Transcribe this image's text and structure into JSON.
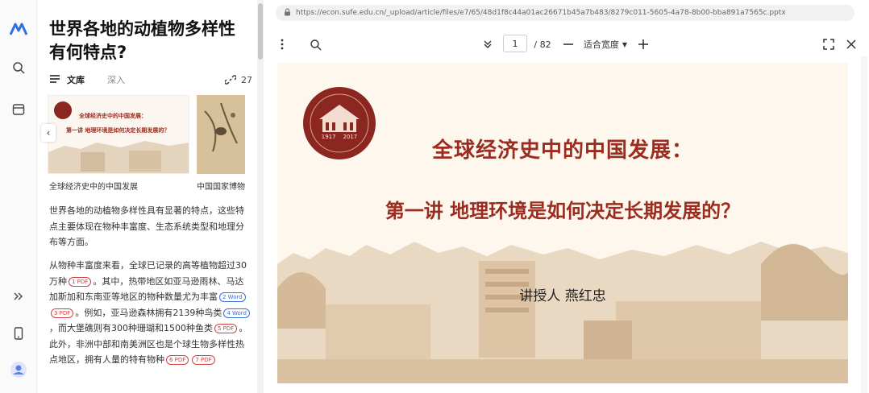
{
  "left_rail": {
    "icons": [
      "brand-logo-icon",
      "search-icon",
      "window-icon",
      "expand-icon",
      "mobile-icon",
      "avatar-icon"
    ]
  },
  "panel": {
    "title_line1": "世界各地的动植物多样性",
    "title_line2": "有何特点?",
    "tab_active": "文库",
    "tab_other": "深入",
    "link_count": "27",
    "card1_caption": "全球经济史中的中国发展",
    "card2_caption": "中国国家博物",
    "card1_thumb_line1": "全球经济史中的中国发展：",
    "card1_thumb_line2": "第一讲 地理环境是如何决定长期发展的？",
    "para1": "世界各地的动植物多样性具有显著的特点，这些特点主要体现在物种丰富度、生态系统类型和地理分布等方面。",
    "para2_a": "从物种丰富度来看，全球已记录的高等植物超过30万种",
    "para2_b": "。其中，热带地区如亚马逊雨林、马达加斯加和东南亚等地区的物种数量尤为丰富",
    "para2_c": "。例如，亚马逊森林拥有2139种鸟类",
    "para2_d": "，而大堡礁则有300种珊瑚和1500种鱼类",
    "para2_e": "。此外，非洲中部和南美洲区也是个球生物多样性热点地区，拥有人量的特有物种",
    "cites": [
      "1 PDF",
      "2 Word",
      "3 PDF",
      "4 Word",
      "5 PDF",
      "6 PDF",
      "7 PDF"
    ]
  },
  "viewer": {
    "url": "https://econ.sufe.edu.cn/_upload/article/files/e7/65/48d1f8c44a01ac26671b45a7b483/8279c011-5605-4a78-8b00-bba891a7565c.pptx",
    "page_current": "1",
    "page_total": "/ 82",
    "zoom_label": "适合宽度",
    "slide": {
      "title1": "全球经济史中的中国发展：",
      "title2": "第一讲  地理环境是如何决定长期发展的？",
      "speaker": "讲授人  燕红忠",
      "emblem_years": "1917    2017"
    }
  },
  "colors": {
    "slide_red": "#9b2c1f",
    "slide_bg": "#fdf7ee",
    "accent_blue": "#3c6fd8"
  }
}
